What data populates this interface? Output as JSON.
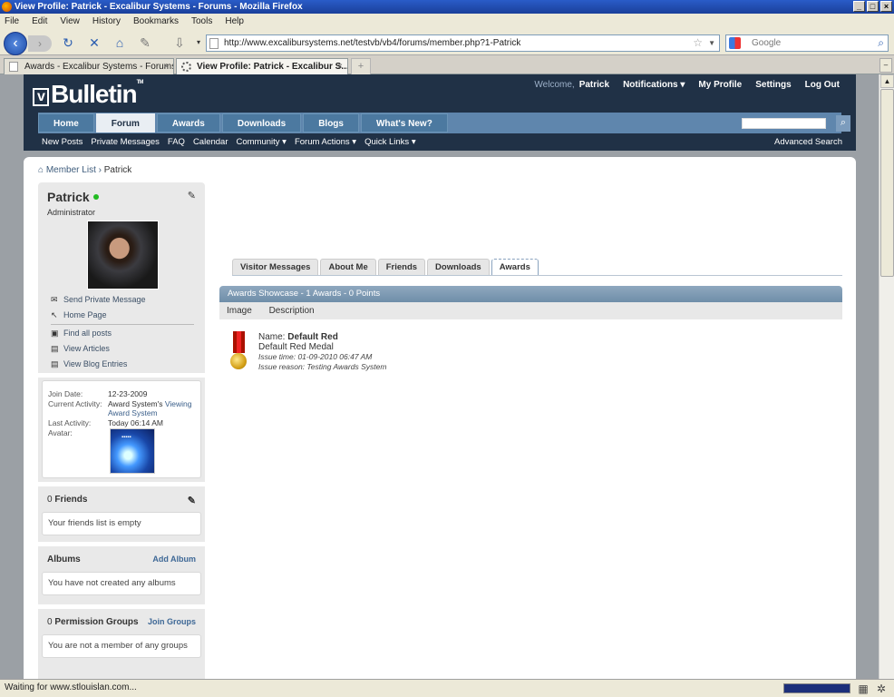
{
  "window": {
    "title": "View Profile: Patrick - Excalibur Systems - Forums - Mozilla Firefox"
  },
  "menu": [
    "File",
    "Edit",
    "View",
    "History",
    "Bookmarks",
    "Tools",
    "Help"
  ],
  "url": "http://www.excalibursystems.net/testvb/vb4/forums/member.php?1-Patrick",
  "search_engine_placeholder": "Google",
  "tabs": [
    {
      "label": "Awards - Excalibur Systems - Forums - ..."
    },
    {
      "label": "View Profile: Patrick - Excalibur S..."
    }
  ],
  "status": "Waiting for www.stlouislan.com...",
  "forum": {
    "logo": "Bulletin",
    "welcome": "Welcome,",
    "user": "Patrick",
    "toplinks": [
      "Notifications ▾",
      "My Profile",
      "Settings",
      "Log Out"
    ],
    "navtabs": [
      "Home",
      "Forum",
      "Awards",
      "Downloads",
      "Blogs",
      "What's New?"
    ],
    "subnav": [
      "New Posts",
      "Private Messages",
      "FAQ",
      "Calendar",
      "Community ▾",
      "Forum Actions ▾",
      "Quick Links ▾"
    ],
    "advanced_search": "Advanced Search"
  },
  "breadcrumb": {
    "parent": "Member List",
    "current": "Patrick"
  },
  "profile": {
    "name": "Patrick",
    "role": "Administrator",
    "links": [
      "Send Private Message",
      "Home Page",
      "Find all posts",
      "View Articles",
      "View Blog Entries"
    ],
    "join_label": "Join Date:",
    "join_value": "12-23-2009",
    "activity_label": "Current Activity:",
    "activity_prefix": "Award System's",
    "activity_link": "Viewing Award System",
    "last_label": "Last Activity:",
    "last_value": "Today 06:14 AM",
    "avatar_label": "Avatar:"
  },
  "friends": {
    "count": "0",
    "label": "Friends",
    "empty": "Your friends list is empty"
  },
  "albums": {
    "label": "Albums",
    "action": "Add Album",
    "empty": "You have not created any albums"
  },
  "groups": {
    "count": "0",
    "label": "Permission Groups",
    "action": "Join Groups",
    "empty": "You are not a member of any groups"
  },
  "profile_tabs": [
    "Visitor Messages",
    "About Me",
    "Friends",
    "Downloads",
    "Awards"
  ],
  "showcase": {
    "title": "Awards Showcase - 1 Awards - 0 Points",
    "col_image": "Image",
    "col_description": "Description"
  },
  "award": {
    "name_label": "Name:",
    "name": "Default Red",
    "description": "Default Red Medal",
    "issue_time": "Issue time: 01-09-2010 06:47 AM",
    "issue_reason": "Issue reason: Testing Awards System"
  }
}
